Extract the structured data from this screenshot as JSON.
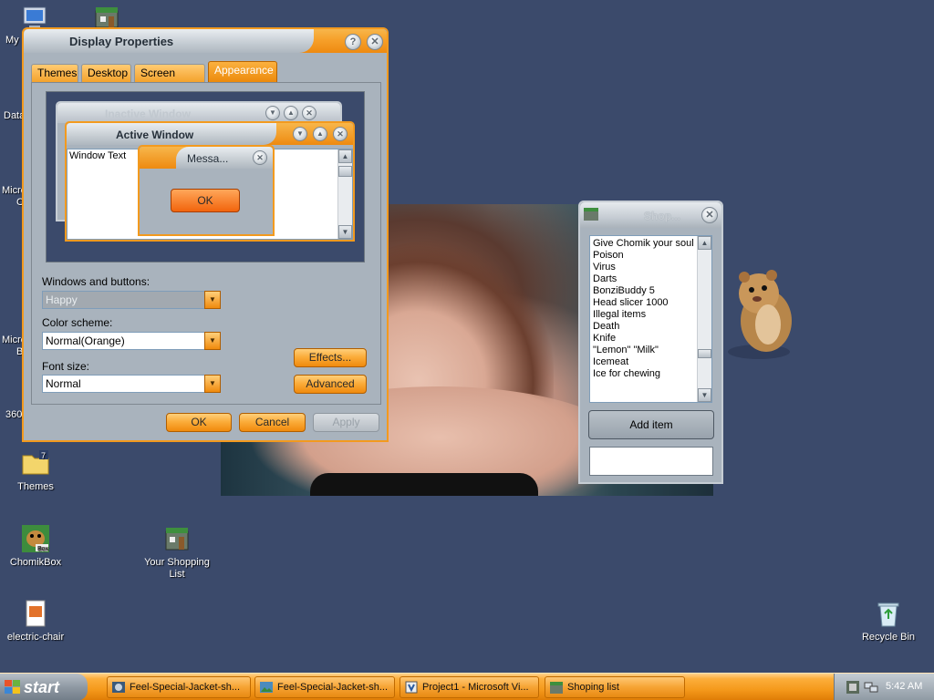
{
  "desktop": {
    "icons": [
      {
        "label": "My",
        "icon": "computer-icon"
      },
      {
        "label": "Data",
        "icon": "folder-icon"
      },
      {
        "label": "Micro\nC",
        "icon": "app-icon"
      },
      {
        "label": "Micro\nB",
        "icon": "app-icon"
      },
      {
        "label": "360",
        "icon": "app-icon"
      },
      {
        "label": "Themes",
        "icon": "folder-icon"
      },
      {
        "label": "ChomikBox",
        "icon": "hamster-icon"
      },
      {
        "label": "Your Shopping List",
        "icon": "shop-icon"
      },
      {
        "label": "electric-chair",
        "icon": "document-icon"
      },
      {
        "label": "Recycle Bin",
        "icon": "recycle-bin-icon"
      }
    ]
  },
  "display_properties": {
    "title": "Display Properties",
    "tabs": [
      "Themes",
      "Desktop",
      "Screen Saver",
      "Appearance"
    ],
    "active_tab": "Appearance",
    "preview": {
      "inactive_title": "Inactive Window",
      "active_title": "Active Window",
      "window_text": "Window Text",
      "message_title": "Messa...",
      "ok": "OK"
    },
    "windows_buttons_label": "Windows and buttons:",
    "windows_buttons_value": "Happy",
    "color_scheme_label": "Color scheme:",
    "color_scheme_value": "Normal(Orange)",
    "font_size_label": "Font size:",
    "font_size_value": "Normal",
    "effects": "Effects...",
    "advanced": "Advanced",
    "ok": "OK",
    "cancel": "Cancel",
    "apply": "Apply"
  },
  "shop": {
    "title": "Shop...",
    "items": [
      "Give Chomik your soul",
      "Poison",
      "Virus",
      "Darts",
      "BonziBuddy 5",
      "Head slicer 1000",
      "Illegal items",
      "Death",
      "Knife",
      "\"Lemon\" \"Milk\"",
      "Icemeat",
      "Ice for chewing"
    ],
    "add_item": "Add item",
    "input_value": ""
  },
  "taskbar": {
    "start": "start",
    "buttons": [
      "Feel-Special-Jacket-sh...",
      "Feel-Special-Jacket-sh...",
      "Project1 - Microsoft Vi...",
      "Shoping list"
    ],
    "clock": "5:42 AM"
  },
  "colors": {
    "accent": "#f39a1e",
    "desktop": "#3b4a6b",
    "window_face": "#a9b3bd"
  }
}
